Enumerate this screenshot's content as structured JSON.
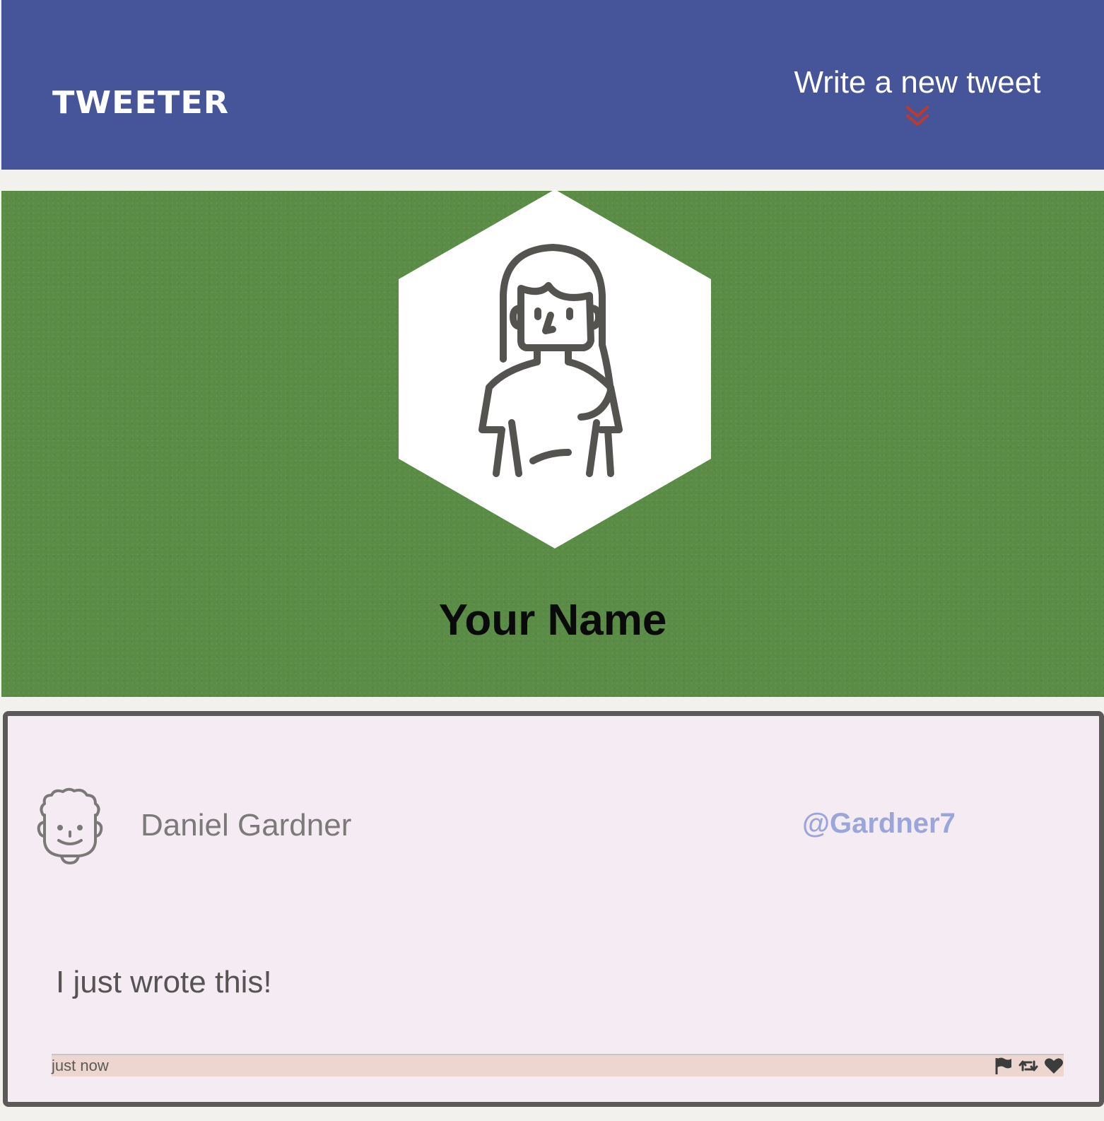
{
  "nav": {
    "brand": "TWEETER",
    "compose_label": "Write a new tweet",
    "compose_icon": "double-chevron-down-icon",
    "compose_icon_color": "#c0392b",
    "background": "#46549a"
  },
  "profile": {
    "name": "Your Name",
    "avatar_icon": "woman-avatar-icon",
    "banner_color": "#5a8c46"
  },
  "tweet": {
    "author": "Daniel Gardner",
    "handle": "@Gardner7",
    "avatar_icon": "curly-hair-man-avatar-icon",
    "text": "I just wrote this!",
    "time": "just now",
    "actions": [
      "flag-icon",
      "retweet-icon",
      "heart-icon"
    ],
    "background": "#f4ebf3"
  }
}
